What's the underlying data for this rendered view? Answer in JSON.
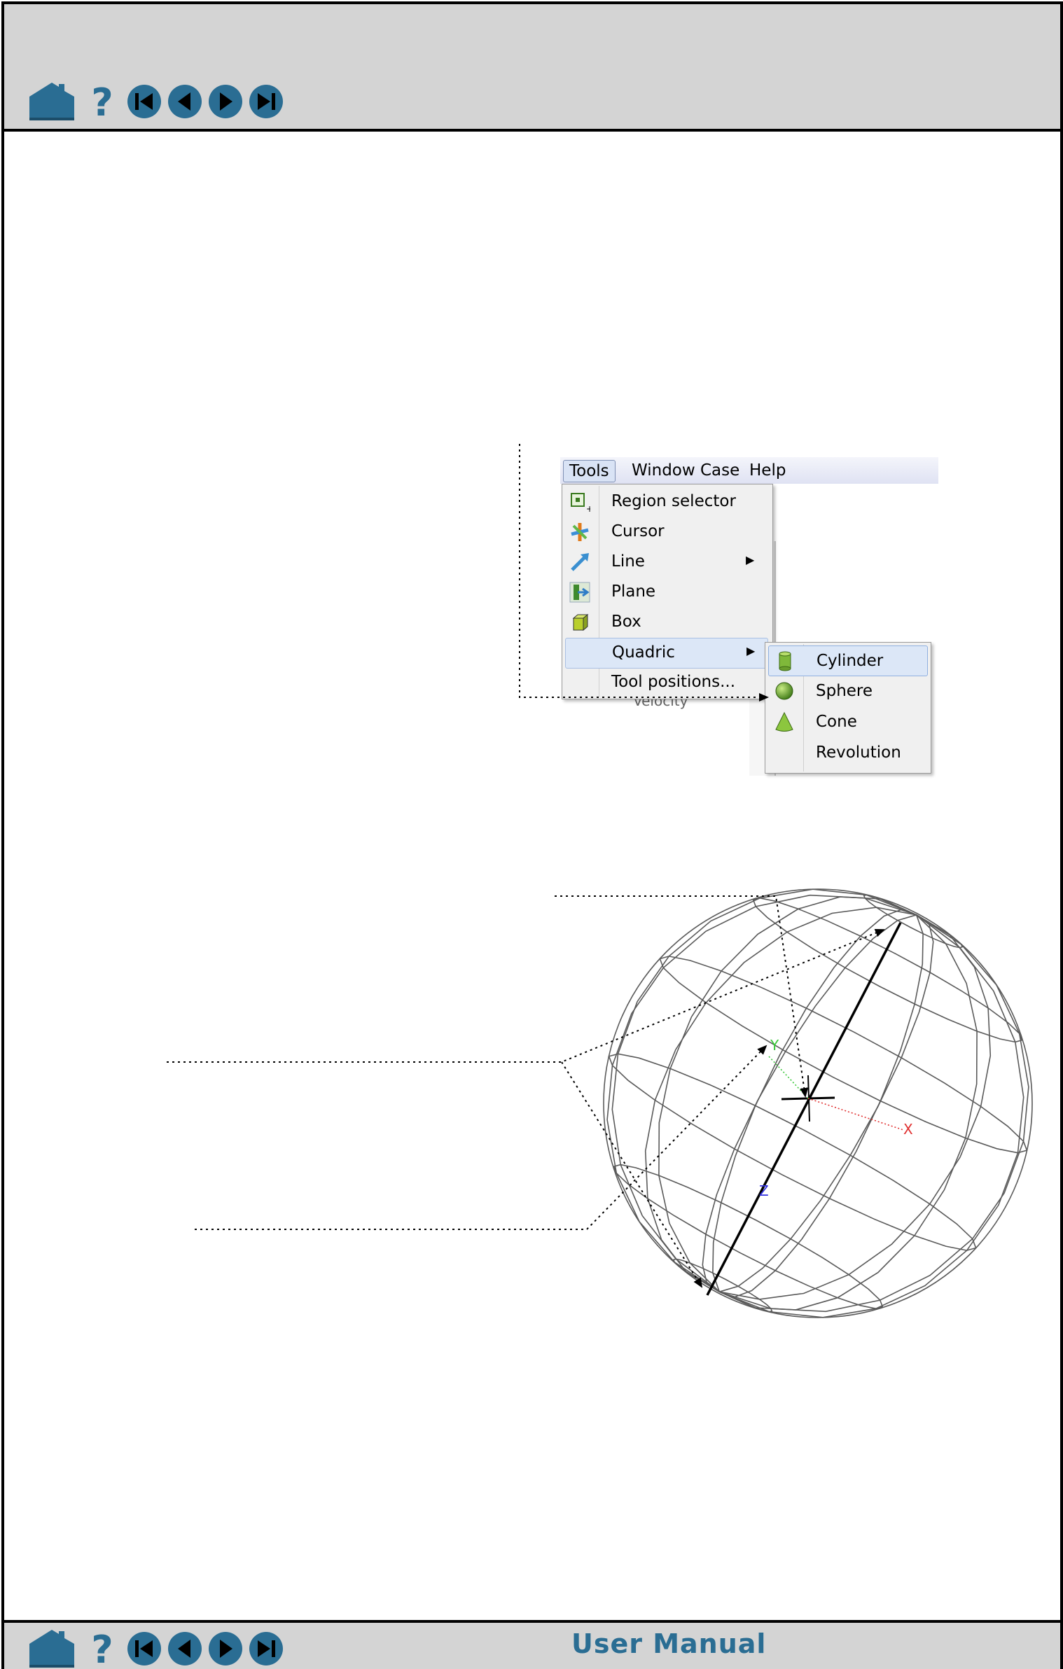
{
  "header": {
    "nav_icons": [
      "home-icon",
      "help-icon",
      "first-page-icon",
      "previous-page-icon",
      "next-page-icon",
      "last-page-icon"
    ]
  },
  "footer": {
    "title": "User Manual",
    "nav_icons": [
      "home-icon",
      "help-icon",
      "first-page-icon",
      "previous-page-icon",
      "next-page-icon",
      "last-page-icon"
    ]
  },
  "menu_screenshot": {
    "menubar": [
      "Tools",
      "Window",
      "Case",
      "Help"
    ],
    "tools_menu": [
      {
        "label": "Region selector",
        "icon": "region-selector-icon"
      },
      {
        "label": "Cursor",
        "icon": "cursor-tool-icon"
      },
      {
        "label": "Line",
        "icon": "line-tool-icon",
        "submenu": true
      },
      {
        "label": "Plane",
        "icon": "plane-tool-icon"
      },
      {
        "label": "Box",
        "icon": "box-tool-icon"
      },
      {
        "label": "Quadric",
        "icon": "",
        "submenu": true,
        "highlighted": true
      },
      {
        "label": "Tool positions...",
        "icon": ""
      }
    ],
    "quadric_submenu": [
      {
        "label": "Cylinder",
        "icon": "cylinder-icon",
        "highlighted": true
      },
      {
        "label": "Sphere",
        "icon": "sphere-icon"
      },
      {
        "label": "Cone",
        "icon": "cone-icon"
      },
      {
        "label": "Revolution",
        "icon": ""
      }
    ],
    "background_text": "Velocity"
  },
  "sphere_figure": {
    "axis_labels": {
      "x": "X",
      "y": "Y",
      "z": "Z"
    },
    "colors": {
      "x": "#e03030",
      "y": "#38c838",
      "z": "#3030e0",
      "wire": "#5a5a5a"
    }
  }
}
